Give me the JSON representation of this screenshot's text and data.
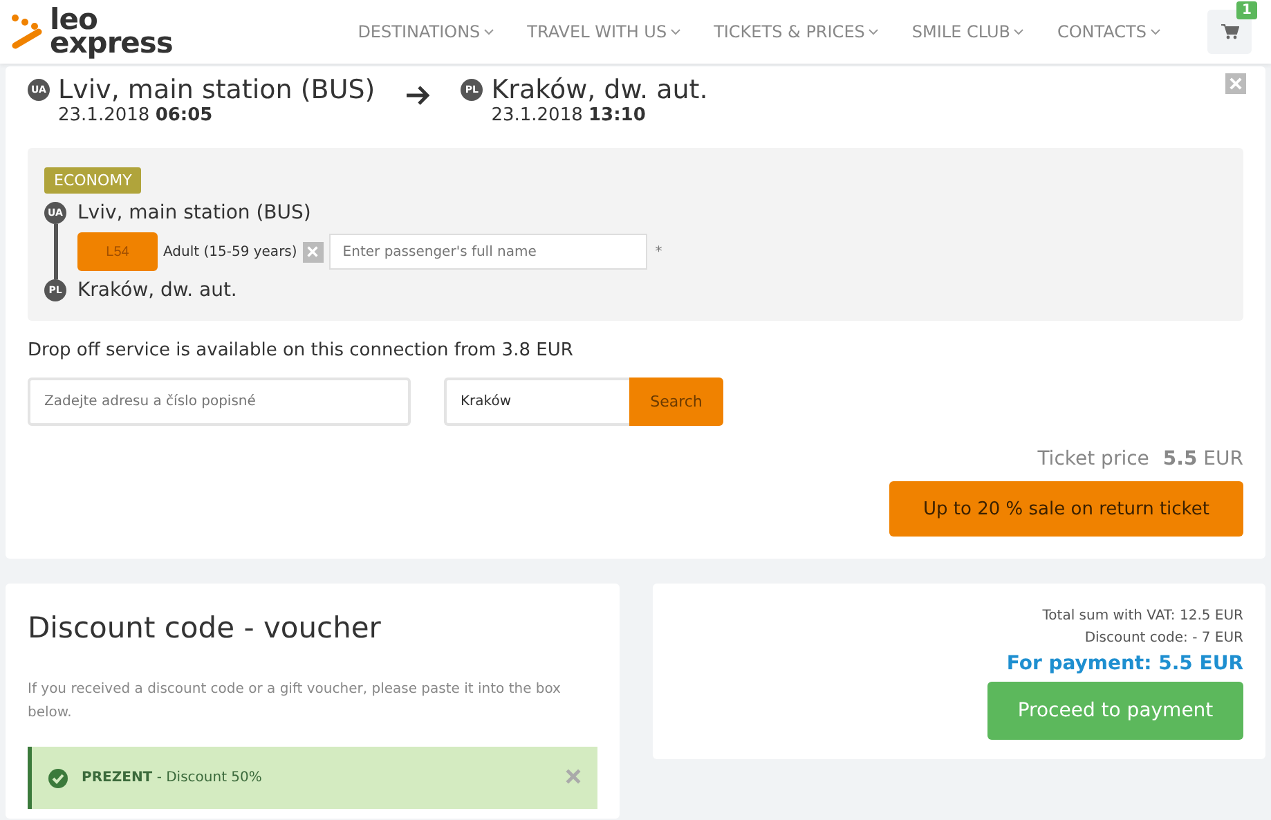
{
  "logo": {
    "line1": "leo",
    "line2": "express"
  },
  "nav": [
    "DESTINATIONS",
    "TRAVEL WITH US",
    "TICKETS & PRICES",
    "SMILE CLUB",
    "CONTACTS"
  ],
  "cart": {
    "count": "1"
  },
  "journey": {
    "from": {
      "country": "UA",
      "name": "Lviv, main station (BUS)",
      "date": "23.1.2018",
      "time": "06:05"
    },
    "to": {
      "country": "PL",
      "name": "Kraków, dw. aut.",
      "date": "23.1.2018",
      "time": "13:10"
    }
  },
  "segment": {
    "class": "ECONOMY",
    "stops": [
      {
        "country": "UA",
        "name": "Lviv, main station (BUS)"
      },
      {
        "country": "PL",
        "name": "Kraków, dw. aut."
      }
    ],
    "passenger": {
      "seat": "L54",
      "type": "Adult (15-59 years)",
      "placeholder": "Enter passenger's full name",
      "required": "*"
    }
  },
  "dropoff": {
    "text": "Drop off service is available on this connection from 3.8 EUR",
    "address_placeholder": "Zadejte adresu a číslo popisné",
    "city": "Kraków",
    "button": "Search"
  },
  "price": {
    "label": "Ticket price",
    "value": "5.5",
    "currency": "EUR"
  },
  "sale_button": "Up to 20 % sale on return ticket",
  "discount": {
    "title": "Discount code - voucher",
    "description": "If you received a discount code or a gift voucher, please paste it into the box below.",
    "voucher": "**PREZENT** - Discount 50%"
  },
  "summary": {
    "total": "Total sum with VAT: 12.5 EUR",
    "discount": "Discount code: - 7 EUR",
    "payment": "For payment: 5.5 EUR",
    "button": "Proceed to payment"
  }
}
